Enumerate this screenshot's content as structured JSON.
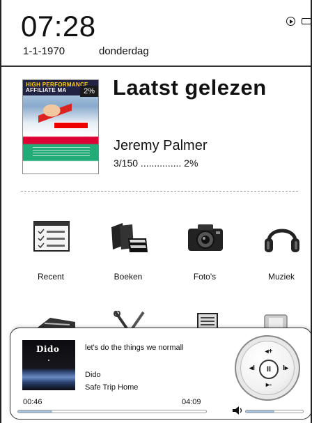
{
  "status": {
    "time": "07:28",
    "date": "1-1-1970",
    "weekday": "donderdag",
    "play_icon": "play-circle-icon",
    "battery_icon": "battery-icon"
  },
  "last_read": {
    "heading": "Laatst gelezen",
    "author": "Jeremy Palmer",
    "progress_text": "3/150 ............... 2%",
    "cover": {
      "header_line1": "HIGH PERFORMANCE",
      "header_line2": "AFFILIATE MA",
      "percent_badge": "2%"
    }
  },
  "apps": [
    {
      "label": "Recent",
      "icon": "checklist-icon"
    },
    {
      "label": "Boeken",
      "icon": "books-icon"
    },
    {
      "label": "Foto's",
      "icon": "camera-icon"
    },
    {
      "label": "Muziek",
      "icon": "headphones-icon"
    }
  ],
  "apps_row2": [
    {
      "icon": "keyboard-icon"
    },
    {
      "icon": "tools-icon"
    },
    {
      "icon": "newspaper-icon"
    },
    {
      "icon": "device-icon"
    }
  ],
  "player": {
    "album_art_text": "Dido",
    "track_title": "let's do the things we normall",
    "artist": "Dido",
    "album": "Safe Trip Home",
    "elapsed": "00:46",
    "total": "04:09",
    "progress": 0.18,
    "volume": 0.5,
    "controls": {
      "up": "◂+",
      "down": "▸-",
      "left": "◂I",
      "right": "I▸",
      "center": "II"
    }
  },
  "colors": {
    "progress_fill": "#aac4e0",
    "border": "#333333"
  }
}
